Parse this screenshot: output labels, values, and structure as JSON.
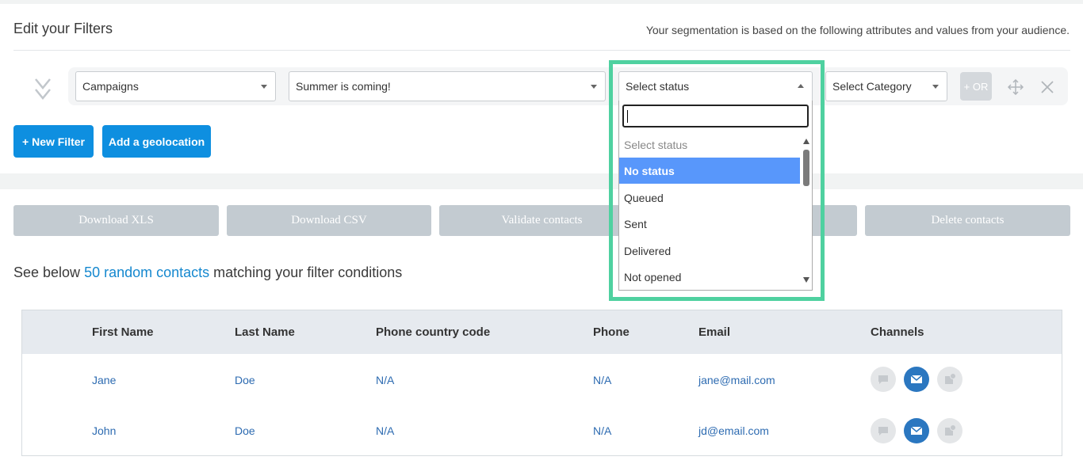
{
  "header": {
    "title": "Edit your Filters",
    "subtitle": "Your segmentation is based on the following attributes and values from your audience."
  },
  "filter": {
    "type_select": "Campaigns",
    "campaign_select": "Summer is coming!",
    "status_select": "Select status",
    "category_select": "Select Category",
    "or_label": "+ OR"
  },
  "status_dropdown": {
    "search_value": "",
    "options": [
      "Select status",
      "No status",
      "Queued",
      "Sent",
      "Delivered",
      "Not opened"
    ],
    "selected": "No status"
  },
  "actions": {
    "new_filter": "+ New Filter",
    "add_geolocation": "Add a geolocation",
    "download_xls": "Download XLS",
    "download_csv": "Download CSV",
    "validate_contacts": "Validate contacts",
    "delete_contacts": "Delete contacts"
  },
  "summary": {
    "prefix": "See below ",
    "link": "50 random contacts",
    "suffix": " matching your filter conditions"
  },
  "table": {
    "headers": [
      "First Name",
      "Last Name",
      "Phone country code",
      "Phone",
      "Email",
      "Channels"
    ],
    "rows": [
      {
        "first": "Jane",
        "last": "Doe",
        "code": "N/A",
        "phone": "N/A",
        "email": "jane@mail.com"
      },
      {
        "first": "John",
        "last": "Doe",
        "code": "N/A",
        "phone": "N/A",
        "email": "jd@email.com"
      }
    ]
  },
  "icons": {
    "drag": "double-chevron-down-icon",
    "move": "move-arrows-icon",
    "close": "close-icon",
    "sms": "chat-bubble-icon",
    "email": "envelope-icon",
    "push": "push-notification-icon"
  },
  "colors": {
    "primary": "#0e8fe0",
    "highlight": "#4fd1a0",
    "selected_option": "#5897fb",
    "disabled_button": "#c3cbd1",
    "link": "#1588cf"
  }
}
